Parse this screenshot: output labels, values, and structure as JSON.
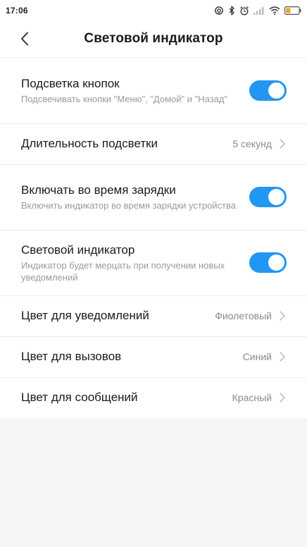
{
  "status_bar": {
    "time": "17:06",
    "icons": [
      "hotspot-icon",
      "bluetooth-icon",
      "alarm-icon",
      "signal-icon",
      "wifi-icon",
      "battery-icon"
    ],
    "battery_color": "#f2a21f"
  },
  "header": {
    "back_icon": "chevron-left-icon",
    "title": "Световой индикатор"
  },
  "settings": {
    "button_backlight": {
      "title": "Подсветка кнопок",
      "subtitle": "Подсвечивать кнопки \"Меню\", \"Домой\" и \"Назад\"",
      "enabled": true
    },
    "backlight_duration": {
      "title": "Длительность подсветки",
      "value": "5 секунд"
    },
    "on_while_charging": {
      "title": "Включать во время зарядки",
      "subtitle": "Включить индикатор во время зарядки устройства",
      "enabled": true
    },
    "notification_light": {
      "title": "Световой индикатор",
      "subtitle": "Индикатор будет мерцать при получении новых уведомлений",
      "enabled": true
    },
    "notification_color": {
      "title": "Цвет для уведомлений",
      "value": "Фиолетовый"
    },
    "call_color": {
      "title": "Цвет для вызовов",
      "value": "Синий"
    },
    "message_color": {
      "title": "Цвет для сообщений",
      "value": "Красный"
    }
  },
  "colors": {
    "accent": "#2196f3",
    "background": "#f5f5f5"
  }
}
